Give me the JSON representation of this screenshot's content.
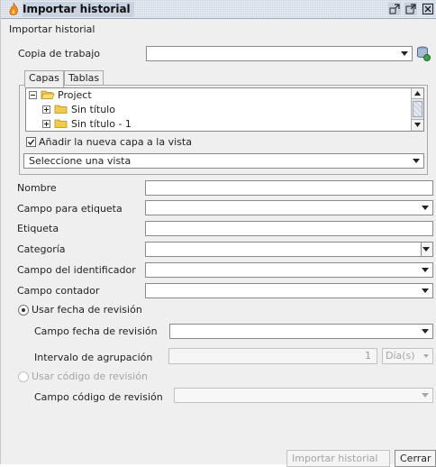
{
  "window": {
    "title": "Importar historial",
    "heading": "Importar historial",
    "controls": [
      "restore-icon",
      "maximize-icon",
      "close-icon"
    ]
  },
  "form": {
    "working_copy_label": "Copia de trabajo",
    "working_copy_value": "",
    "tabs": [
      {
        "label": "Capas",
        "active": true
      },
      {
        "label": "Tablas",
        "active": false
      }
    ],
    "tree": [
      {
        "label": "Project",
        "icon": "folder-open-icon",
        "level": 0,
        "expander": "minus"
      },
      {
        "label": "Sin título",
        "icon": "folder-icon",
        "level": 1,
        "expander": "plus"
      },
      {
        "label": "Sin título - 1",
        "icon": "folder-icon",
        "level": 1,
        "expander": "plus"
      }
    ],
    "add_layer_label": "Añadir la nueva capa a la vista",
    "add_layer_checked": true,
    "view_select_value": "Seleccione una vista",
    "name_label": "Nombre",
    "label_field_label": "Campo para etiqueta",
    "label_label": "Etiqueta",
    "category_label": "Categoría",
    "id_field_label": "Campo del identificador",
    "counter_field_label": "Campo contador",
    "use_date_label": "Usar fecha de revisión",
    "date_field_label": "Campo fecha de revisión",
    "interval_label": "Intervalo de agrupación",
    "interval_value": "1",
    "interval_units": "Día(s)",
    "use_code_label": "Usar código de revisión",
    "code_field_label": "Campo código de revisión"
  },
  "buttons": {
    "import": "Importar historial",
    "close": "Cerrar"
  },
  "colors": {
    "titlebar": "#c9d3e0",
    "folder": "#f3c94a",
    "disabled_text": "#a4a4a4"
  }
}
